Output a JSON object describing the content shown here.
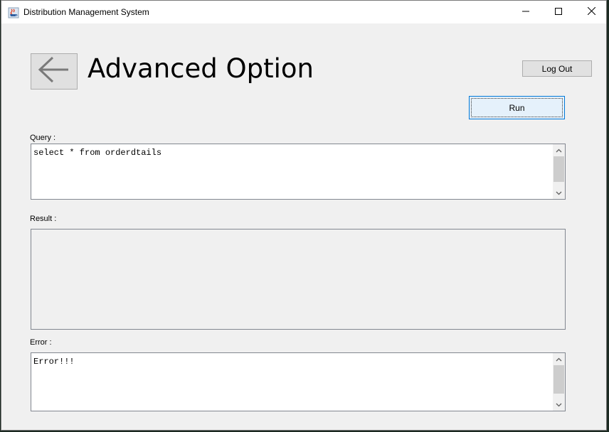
{
  "window": {
    "title": "Distribution Management System",
    "icon": "java-cup-icon"
  },
  "header": {
    "back_icon": "arrow-left-icon",
    "title": "Advanced Option",
    "logout_label": "Log Out"
  },
  "toolbar": {
    "run_label": "Run"
  },
  "query": {
    "label": "Query :",
    "value": "select * from orderdtails"
  },
  "result": {
    "label": "Result :",
    "value": ""
  },
  "error": {
    "label": "Error :",
    "value": "Error!!!"
  },
  "colors": {
    "window_bg": "#f0f0f0",
    "focus_border": "#0078d7",
    "run_bg": "#e5f1fb"
  }
}
